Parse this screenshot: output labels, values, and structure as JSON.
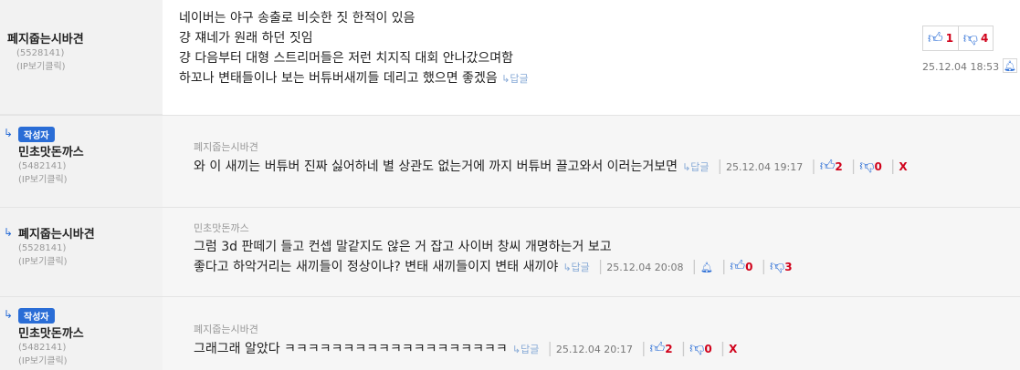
{
  "comments": [
    {
      "nick": "페지줍는시바견",
      "uid": "(5528141)",
      "ip": "(IP보기클릭)",
      "lines": [
        "네이버는 야구 송출로 비슷한 짓 한적이 있음",
        "걍 쟤네가 원래 하던 짓임",
        "걍 다음부터 대형 스트리머들은 저런 치지직 대회 안나갔으며함",
        "하꼬나 변태들이나 보는 버튜버새끼들 데리고 했으면 좋겠음"
      ],
      "reply_label": "답글",
      "up": "1",
      "down": "4",
      "date": "25.12.04 18:53"
    },
    {
      "badge": "작성자",
      "nick": "민초맛돈까스",
      "uid": "(5482141)",
      "ip": "(IP보기클릭)",
      "target": "폐지줍는시바견",
      "text": "와 이 새끼는 버튜버 진짜 싫어하네 별 상관도 없는거에 까지 버튜버 끌고와서 이러는거보면",
      "reply_label": "답글",
      "date": "25.12.04 19:17",
      "up": "2",
      "down": "0",
      "delete": "X"
    },
    {
      "nick": "폐지줍는시바견",
      "uid": "(5528141)",
      "ip": "(IP보기클릭)",
      "target": "민초맛돈까스",
      "lines": [
        "그럼 3d 판떼기 들고 컨셉 말같지도 않은 거 잡고 사이버 창씨 개명하는거 보고",
        "좋다고 하악거리는 새끼들이 정상이냐? 변태 새끼들이지 변태 새끼야"
      ],
      "reply_label": "답글",
      "date": "25.12.04 20:08",
      "up": "0",
      "down": "3"
    },
    {
      "badge": "작성자",
      "nick": "민초맛돈까스",
      "uid": "(5482141)",
      "ip": "(IP보기클릭)",
      "target": "폐지줍는시바견",
      "text": "그래그래 알았다 ㅋㅋㅋㅋㅋㅋㅋㅋㅋㅋㅋㅋㅋㅋㅋㅋㅋㅋㅋ",
      "reply_label": "답글",
      "date": "25.12.04 20:17",
      "up": "2",
      "down": "0",
      "delete": "X"
    }
  ],
  "colors": {
    "accent": "#2a6dd6",
    "vote": "#d0021b"
  }
}
